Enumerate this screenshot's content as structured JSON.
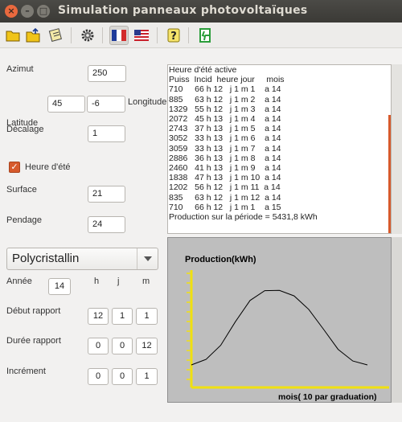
{
  "window": {
    "title": "Simulation panneaux photovoltaïques",
    "close_glyph": "×",
    "minimize_glyph": "–",
    "maximize_glyph": "□"
  },
  "toolbar": {
    "items": [
      "open-folder-icon",
      "export-icon",
      "print-icon",
      "settings-gear-icon",
      "french-flag-icon",
      "us-flag-icon",
      "help-icon",
      "exit-icon"
    ],
    "help_glyph": "?"
  },
  "form": {
    "azimut_label": "Azimut",
    "azimut_value": "250",
    "latitude_label": "Latitude",
    "latitude_value": "45",
    "longitude_value": "-6",
    "longitude_label": "Longitude",
    "decalage_label": "Décalage",
    "decalage_value": "1",
    "heure_ete_label": "Heure d'été",
    "heure_ete_checked": true,
    "check_glyph": "✓",
    "surface_label": "Surface",
    "surface_value": "21",
    "pendage_label": "Pendage",
    "pendage_value": "24",
    "panel_type": "Polycristallin",
    "annee_label": "Année",
    "annee_value": "14",
    "col_h": "h",
    "col_j": "j",
    "col_m": "m",
    "debut_label": "Début rapport",
    "debut_h": "12",
    "debut_j": "1",
    "debut_m": "1",
    "duree_label": "Durée rapport",
    "duree_h": "0",
    "duree_j": "0",
    "duree_m": "12",
    "increment_label": "Incrément",
    "increment_h": "0",
    "increment_j": "0",
    "increment_m": "1"
  },
  "report": {
    "lines": [
      "Heure d'été active",
      "Puiss  Incid  heure jour     mois",
      "710     66 h 12   j 1 m 1    a 14",
      "885     63 h 12   j 1 m 2    a 14",
      "1329   55 h 12   j 1 m 3    a 14",
      "2072   45 h 13   j 1 m 4    a 14",
      "2743   37 h 13   j 1 m 5    a 14",
      "3052   33 h 13   j 1 m 6    a 14",
      "3059   33 h 13   j 1 m 7    a 14",
      "2886   36 h 13   j 1 m 8    a 14",
      "2460   41 h 13   j 1 m 9    a 14",
      "1838   47 h 13   j 1 m 10  a 14",
      "1202   56 h 12   j 1 m 11  a 14",
      "835     63 h 12   j 1 m 12  a 14",
      "710     66 h 12   j 1 m 1    a 15",
      "Production sur la période = 5431,8 kWh"
    ]
  },
  "chart_data": {
    "type": "line",
    "title": "Production(kWh)",
    "xlabel": "mois(   10 par graduation)",
    "x": [
      1,
      2,
      3,
      4,
      5,
      6,
      7,
      8,
      9,
      10,
      11,
      12,
      13
    ],
    "series": [
      {
        "values": [
          710,
          885,
          1329,
          2072,
          2743,
          3052,
          3059,
          2886,
          2460,
          1838,
          1202,
          835,
          710
        ]
      }
    ],
    "ylim": [
      0,
      3700
    ],
    "axis_color": "#f0e010",
    "line_color": "#000000"
  }
}
